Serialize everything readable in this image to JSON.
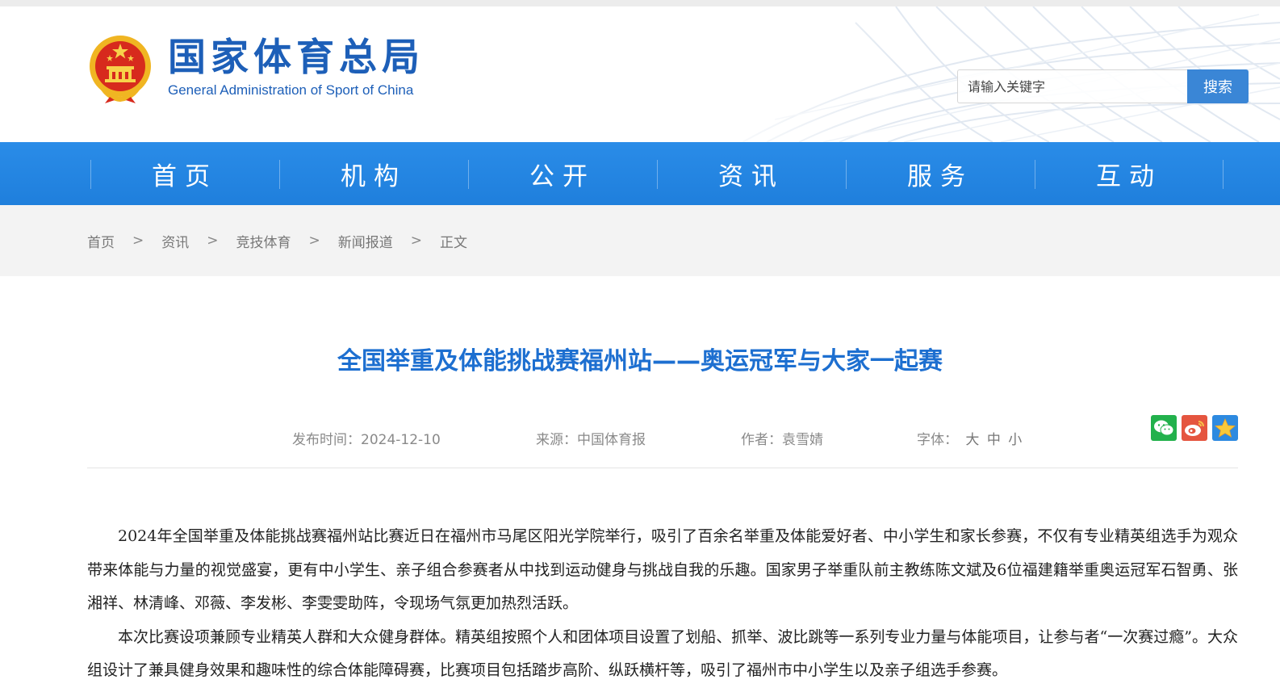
{
  "header": {
    "site_name_cn": "国家体育总局",
    "site_name_en": "General Administration of Sport of China",
    "search": {
      "placeholder": "请输入关键字",
      "button_label": "搜索"
    }
  },
  "nav": {
    "items": [
      {
        "label": "首页"
      },
      {
        "label": "机构"
      },
      {
        "label": "公开"
      },
      {
        "label": "资讯"
      },
      {
        "label": "服务"
      },
      {
        "label": "互动"
      }
    ]
  },
  "breadcrumb": {
    "items": [
      "首页",
      "资讯",
      "竞技体育",
      "新闻报道",
      "正文"
    ],
    "separator": ">"
  },
  "article": {
    "title": "全国举重及体能挑战赛福州站——奥运冠军与大家一起赛",
    "meta": {
      "date": "发布时间：2024-12-10",
      "source": "来源：中国体育报",
      "author": "作者：袁雪婧",
      "font_label": "字体：",
      "font_large": "大",
      "font_medium": "中",
      "font_small": "小"
    },
    "paragraphs": [
      "2024年全国举重及体能挑战赛福州站比赛近日在福州市马尾区阳光学院举行，吸引了百余名举重及体能爱好者、中小学生和家长参赛，不仅有专业精英组选手为观众带来体能与力量的视觉盛宴，更有中小学生、亲子组合参赛者从中找到运动健身与挑战自我的乐趣。国家男子举重队前主教练陈文斌及6位福建籍举重奥运冠军石智勇、张湘祥、林清峰、邓薇、李发彬、李雯雯助阵，令现场气氛更加热烈活跃。",
      "本次比赛设项兼顾专业精英人群和大众健身群体。精英组按照个人和团体项目设置了划船、抓举、波比跳等一系列专业力量与体能项目，让参与者“一次赛过瘾”。大众组设计了兼具健身效果和趣味性的综合体能障碍赛，比赛项目包括踏步高阶、纵跃横杆等，吸引了福州市中小学生以及亲子组选手参赛。"
    ]
  },
  "share": {
    "icons": [
      "wechat-icon",
      "weibo-icon",
      "qzone-icon"
    ]
  },
  "colors": {
    "brand_blue": "#1d5fb8",
    "nav_blue": "#2185e3",
    "title_blue": "#1d6fd0",
    "search_button": "#3a86d6"
  }
}
